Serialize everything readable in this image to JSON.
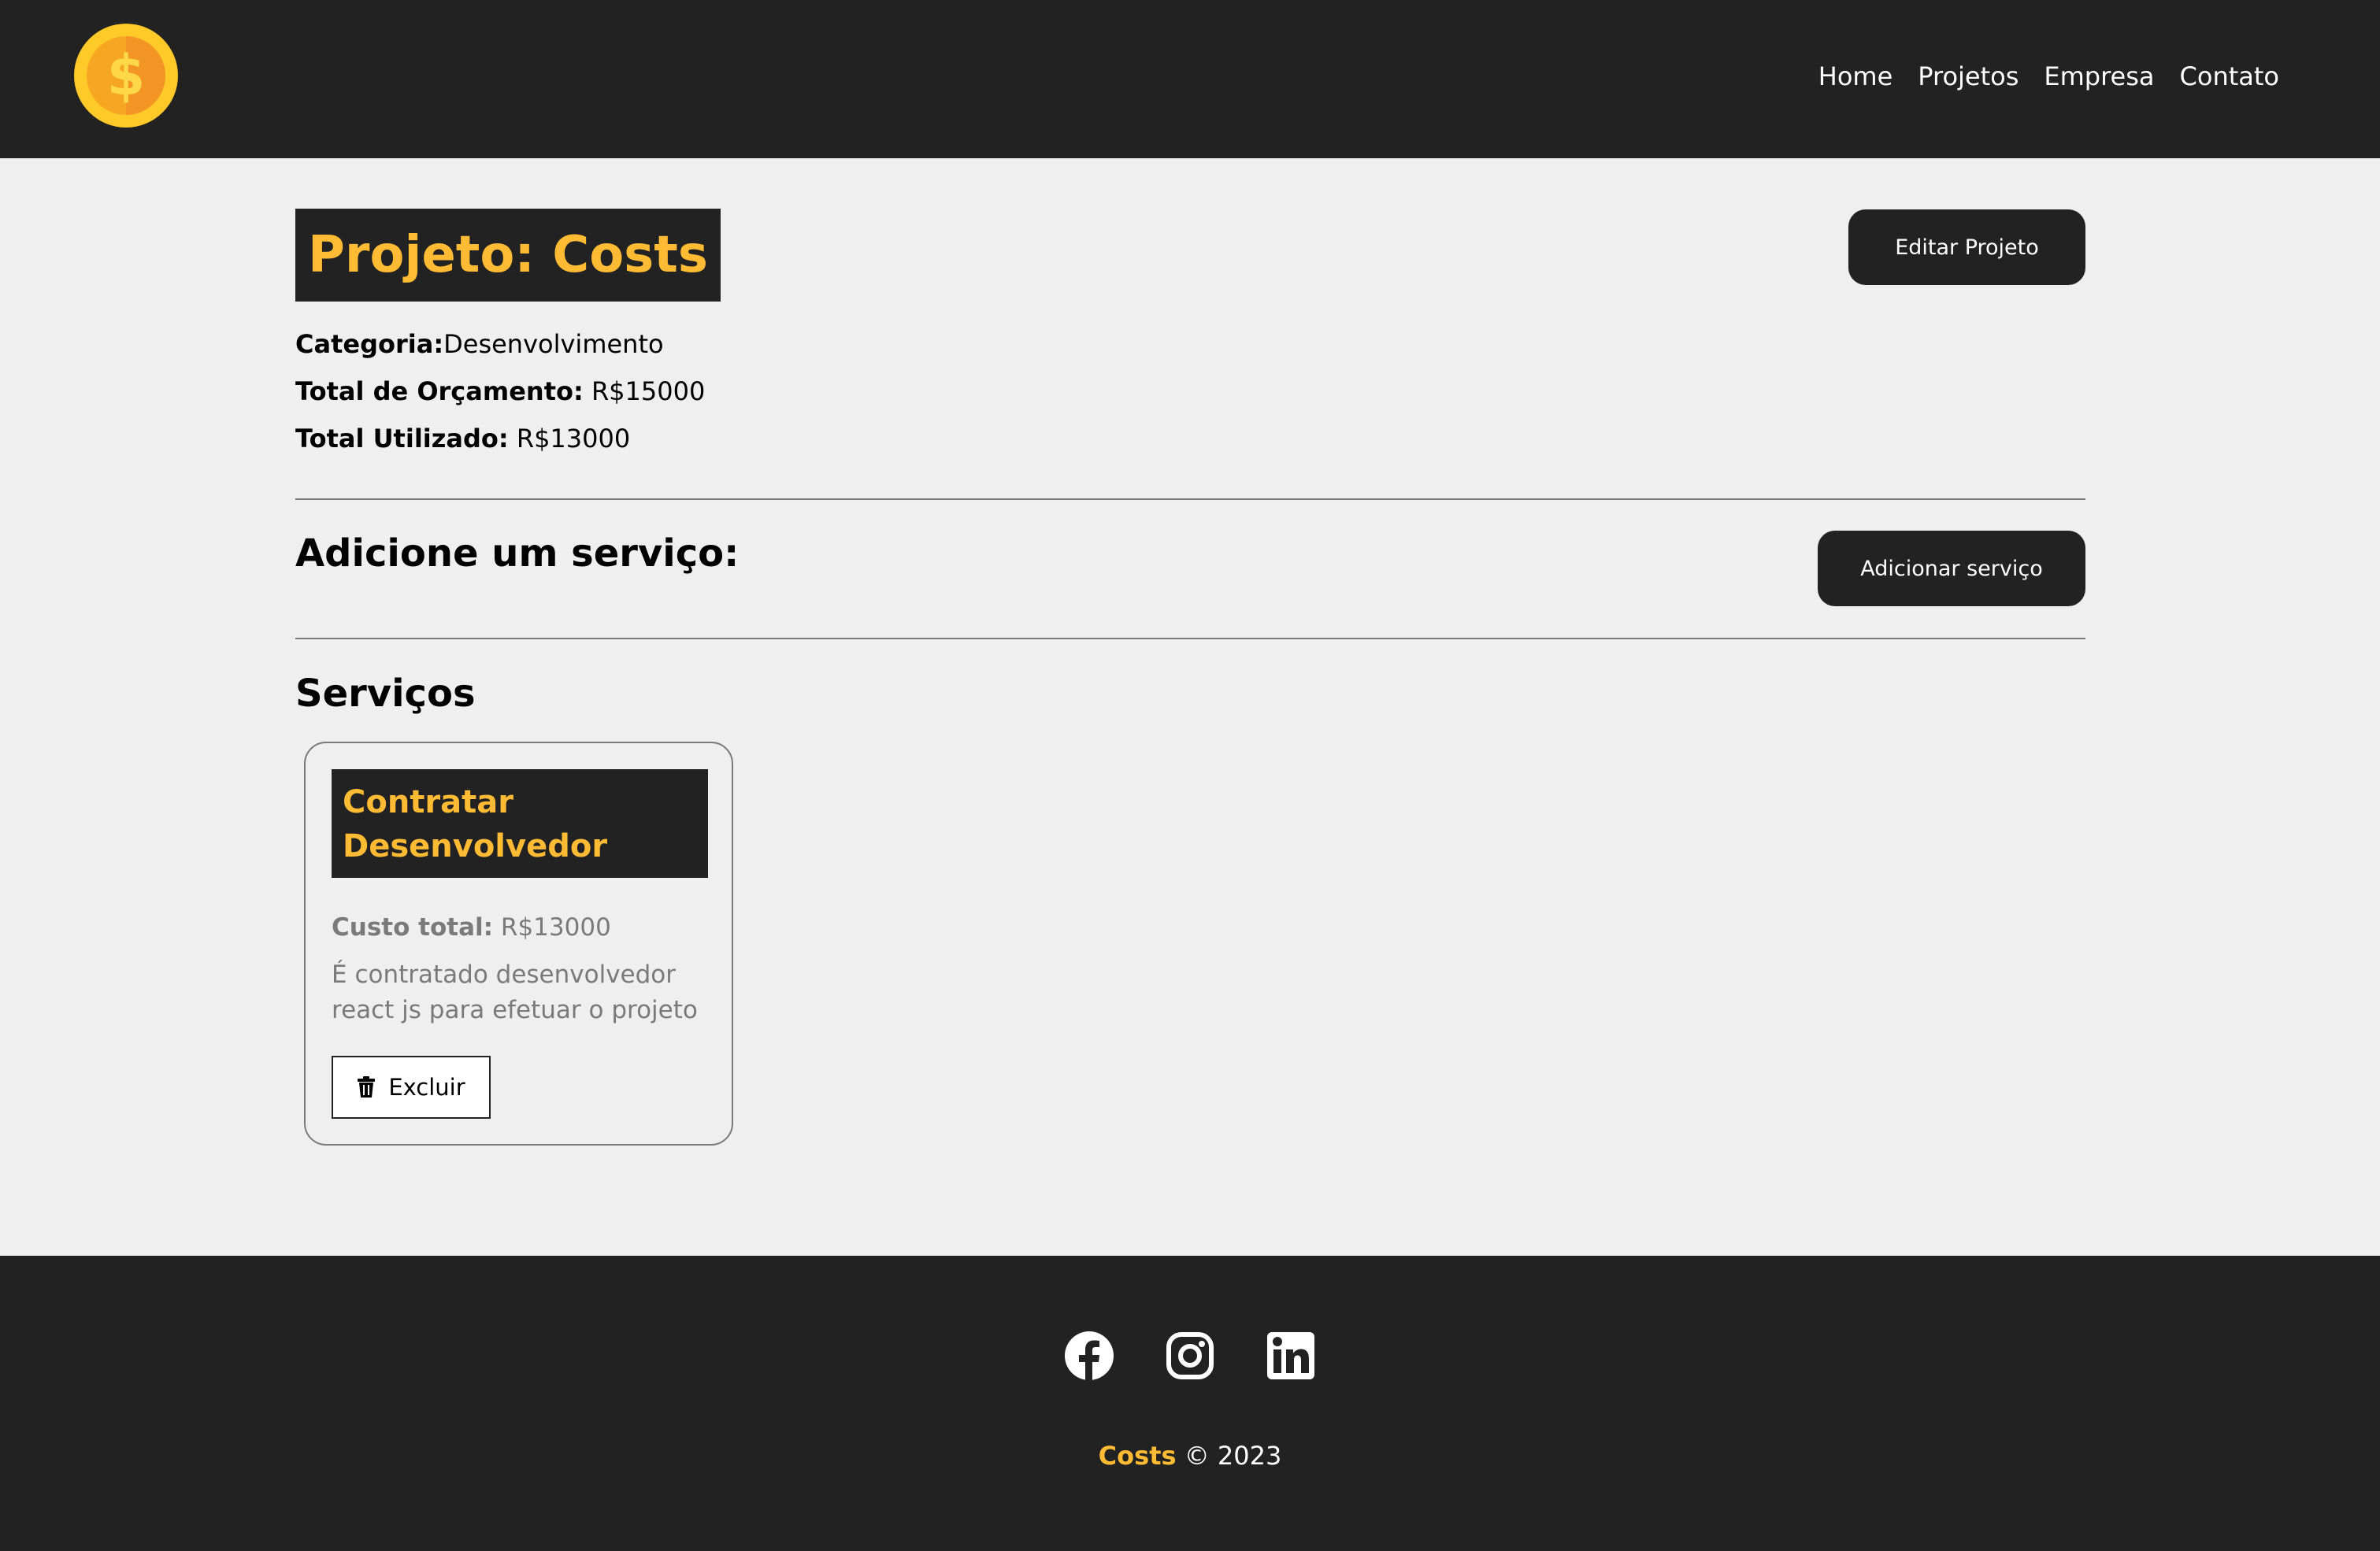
{
  "colors": {
    "dark": "#222222",
    "accent": "#ffbb33",
    "background": "#efefef",
    "muted": "#7a7a7a"
  },
  "navbar": {
    "logo_icon": "dollar-coin-icon",
    "links": [
      "Home",
      "Projetos",
      "Empresa",
      "Contato"
    ]
  },
  "project": {
    "title": "Projeto: Costs",
    "edit_label": "Editar Projeto",
    "category_label": "Categoria:",
    "category_value": "Desenvolvimento",
    "budget_label": "Total de Orçamento:",
    "budget_value": "R$15000",
    "used_label": "Total Utilizado:",
    "used_value": "R$13000"
  },
  "add_service": {
    "heading": "Adicione um serviço:",
    "button_label": "Adicionar serviço"
  },
  "services": {
    "heading": "Serviços",
    "items": [
      {
        "name": "Contratar Desenvolvedor",
        "cost_label": "Custo total:",
        "cost_value": "R$13000",
        "description": "É contratado desenvolvedor react js para efetuar o projeto",
        "delete_label": "Excluir",
        "delete_icon": "trash-icon"
      }
    ]
  },
  "footer": {
    "social_icons": [
      "facebook-icon",
      "instagram-icon",
      "linkedin-icon"
    ],
    "brand": "Costs",
    "copyright": "© 2023"
  }
}
